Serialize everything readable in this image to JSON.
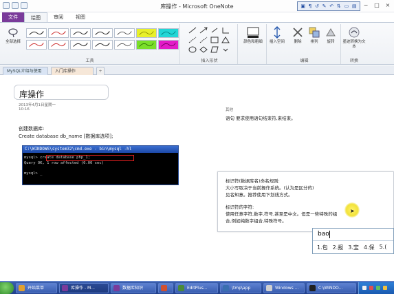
{
  "window": {
    "title": "库操作 - Microsoft OneNote"
  },
  "dock_toolbar": [
    "▣",
    "¶",
    "↺",
    "✎",
    "↶",
    "⇅",
    "▭",
    "▤"
  ],
  "window_controls": [
    "−",
    "□",
    "×"
  ],
  "ribbon_tabs": [
    "文件",
    "绘图",
    "审阅",
    "视图"
  ],
  "ribbon": {
    "select_label": "全部选择",
    "tools_label": "工具",
    "shapes_label": "插入形状",
    "color_label": "颜色和粗细",
    "insert_space_label": "插入空间",
    "delete_label": "删除",
    "arrange_label": "排列",
    "rotate_label": "旋转",
    "edit_label": "编辑",
    "ink_to_text_label": "墨迹转换为文本",
    "convert_label": "转换"
  },
  "colors": {
    "file_tab": "#7a3b9a",
    "ink_black": "#222222",
    "ink_red": "#cc2a2a",
    "highlighter_yellow": "#e8f02a",
    "highlighter_cyan": "#21d6d6",
    "highlighter_magenta": "#e21ac8",
    "highlighter_green": "#7adf2a",
    "cmd_highlight": "#e02020",
    "taskbar": "#2a4c9c"
  },
  "section_tabs": [
    {
      "label": "MySQL介绍与使用"
    },
    {
      "label": "入门库操作"
    },
    {
      "label": "+"
    }
  ],
  "page": {
    "title": "库操作",
    "date": "2013年4月1日星期一",
    "time": "10:16",
    "heading": "创建数据库:",
    "syntax": "Create database db_name [数据库选项];",
    "right_note_1": "其他",
    "right_note_2": "语句 要求使用语句结束符,来结束。"
  },
  "cmd": {
    "title": "C:\\WINDOWS\\system32\\cmd.exe - bin\\mysql -hl",
    "line_1": "mysql> create database php_1;",
    "line_2": "Query OK, 1 row affected (0.00 sec)",
    "line_3": "mysql> _"
  },
  "popup": {
    "line_1": "标识符(数据库名)命名规则:",
    "line_2": "大小写取决于当前操作系统。(认为是区分的)",
    "line_3": "见名知意。推荐使用下划线方式。",
    "line_4": "标识符的字符:",
    "line_5": "使用任意字符,数字,符号,甚至是中文。但是一些特殊的组",
    "line_6": "合,例如纯数字组合,特殊符号。"
  },
  "ime": {
    "input": "bao",
    "candidates": [
      "1.包",
      "2.报",
      "3.宝",
      "4.保",
      "5.("
    ]
  },
  "taskbar": {
    "items": [
      {
        "label": "开始菜单",
        "color": "#e0a030"
      },
      {
        "label": "库操作 - M...",
        "color": "#7a3b9a"
      },
      {
        "label": "数据库知识",
        "color": "#7a3b9a"
      },
      {
        "label": "",
        "color": "#d05030"
      },
      {
        "label": "EditPlus...",
        "color": "#4a8a3a"
      },
      {
        "label": "\\tmp\\app",
        "color": "#3a6fb0"
      },
      {
        "label": "Windows ...",
        "color": "#d0d0d0"
      },
      {
        "label": "C:\\WINDO...",
        "color": "#202020"
      }
    ]
  }
}
